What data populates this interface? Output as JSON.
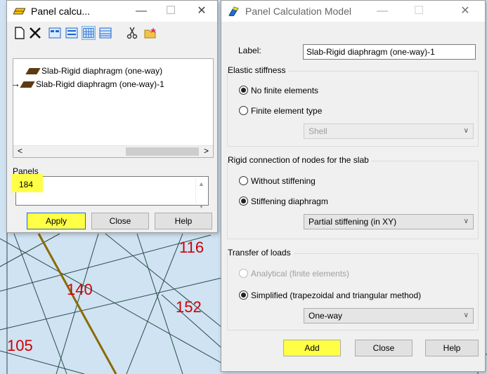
{
  "background": {
    "node_labels": [
      {
        "text": "116",
        "color": "#d00000"
      },
      {
        "text": "140",
        "color": "#d00000"
      },
      {
        "text": "152",
        "color": "#d00000"
      },
      {
        "text": "105",
        "color": "#d00000"
      }
    ],
    "grid_color": "#2a4d46",
    "fill_color": "#cfe3f3",
    "beam_color": "#8a6a00"
  },
  "left_window": {
    "title": "Panel calcu...",
    "toolbar_icons": [
      "new-document-icon",
      "delete-icon",
      "view-icon-1",
      "view-icon-2",
      "view-icon-3",
      "view-icon-4",
      "cut-icon",
      "open-folder-icon"
    ],
    "tree_items": [
      {
        "label": "Slab-Rigid diaphragm (one-way)",
        "current": false
      },
      {
        "label": "Slab-Rigid diaphragm (one-way)-1",
        "current": true
      }
    ],
    "panels_label": "Panels",
    "panels_value": "184",
    "buttons": {
      "apply": "Apply",
      "close": "Close",
      "help": "Help"
    }
  },
  "right_window": {
    "title": "Panel Calculation Model",
    "label_caption": "Label:",
    "label_value": "Slab-Rigid diaphragm (one-way)-1",
    "elastic": {
      "title": "Elastic stiffness",
      "no_fe": "No finite elements",
      "fe_type": "Finite element type",
      "fe_select": "Shell",
      "selected": "no_fe"
    },
    "rigid": {
      "title": "Rigid connection of nodes for the slab",
      "without": "Without stiffening",
      "stiff_diaphragm": "Stiffening diaphragm",
      "stiff_select": "Partial stiffening (in XY)",
      "selected": "stiff_diaphragm"
    },
    "transfer": {
      "title": "Transfer of loads",
      "analytical": "Analytical (finite elements)",
      "simplified": "Simplified (trapezoidal and triangular method)",
      "method_select": "One-way",
      "selected": "simplified"
    },
    "buttons": {
      "add": "Add",
      "close": "Close",
      "help": "Help"
    }
  },
  "highlight_color": "#ffff45",
  "window_controls": {
    "minimize": "—",
    "maximize": "☐",
    "close": "✕"
  }
}
